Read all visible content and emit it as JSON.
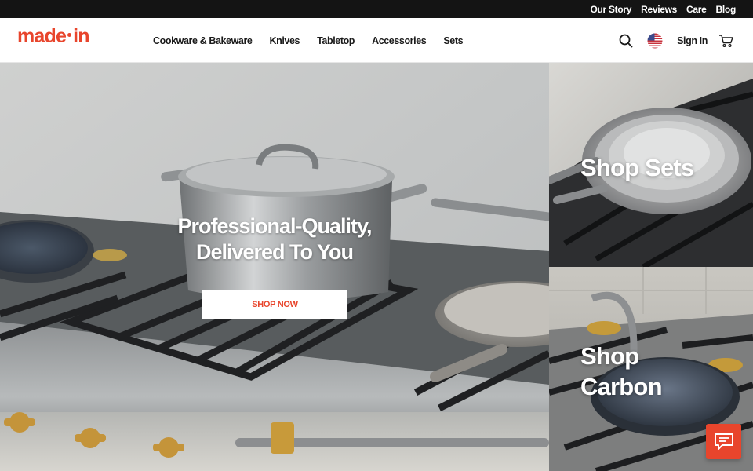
{
  "topbar": {
    "links": [
      "Our Story",
      "Reviews",
      "Care",
      "Blog"
    ]
  },
  "header": {
    "logo": "made·in",
    "logo_left": "made",
    "logo_right": "in",
    "nav": [
      "Cookware & Bakeware",
      "Knives",
      "Tabletop",
      "Accessories",
      "Sets"
    ],
    "signin": "Sign In",
    "icons": [
      "search-icon",
      "us-flag-icon",
      "cart-icon"
    ]
  },
  "hero": {
    "title_line1": "Professional-Quality,",
    "title_line2": "Delivered To You",
    "cta": "SHOP NOW"
  },
  "tiles": {
    "sets": "Shop Sets",
    "carbon_line1": "Shop",
    "carbon_line2": "Carbon"
  },
  "chat": {
    "icon": "chat-icon"
  },
  "colors": {
    "brand": "#e8452c",
    "topbar_bg": "#141414",
    "text": "#1a1a1a"
  }
}
